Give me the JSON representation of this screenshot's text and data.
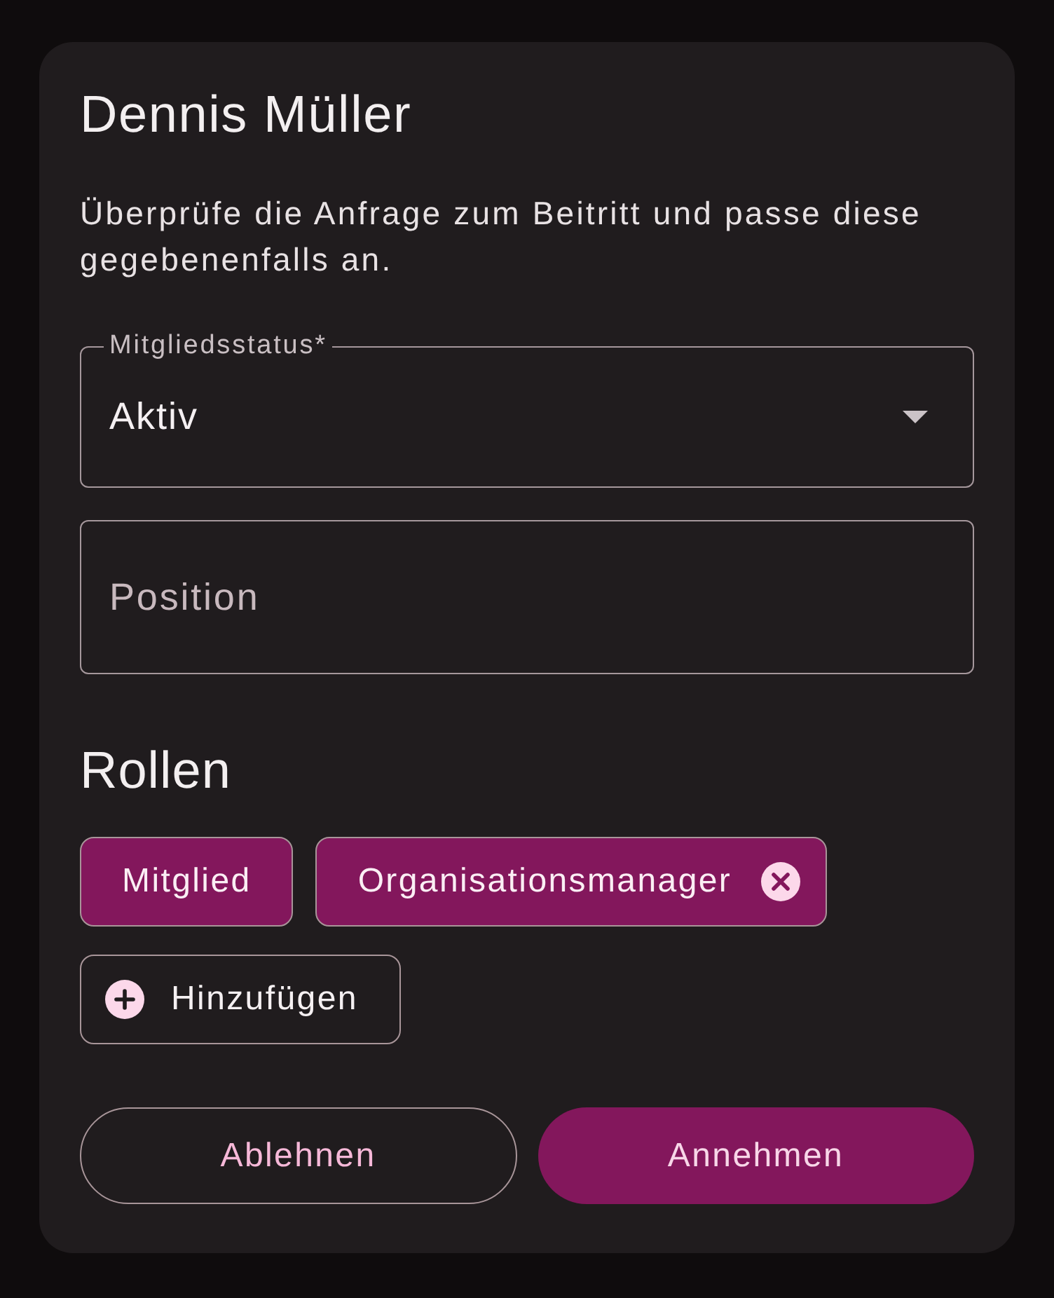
{
  "dialog": {
    "title": "Dennis Müller",
    "description": "Überprüfe die Anfrage zum Beitritt und passe diese gegebenenfalls an.",
    "fields": [
      {
        "kind": "select",
        "label": "Mitgliedsstatus*",
        "value": "Aktiv"
      },
      {
        "kind": "text",
        "placeholder": "Position"
      }
    ],
    "roles_heading": "Rollen",
    "roles": [
      {
        "label": "Mitglied",
        "removable": false
      },
      {
        "label": "Organisationsmanager",
        "removable": true
      }
    ],
    "add_role": {
      "label": "Hinzufügen"
    },
    "buttons": [
      {
        "kind": "outlined",
        "label": "Ablehnen"
      },
      {
        "kind": "filled",
        "label": "Annehmen"
      }
    ]
  }
}
